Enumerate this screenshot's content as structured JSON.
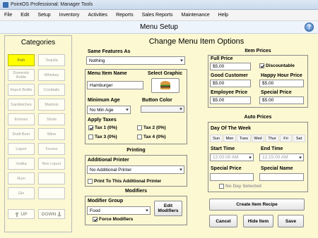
{
  "window": {
    "title": "PointOS Professional: Manager Tools"
  },
  "menu": [
    "File",
    "Edit",
    "Setup",
    "Inventory",
    "Activities",
    "Reports",
    "Sales Reports",
    "Maintenance",
    "Help"
  ],
  "header": {
    "title": "Menu Setup",
    "help_icon": "?"
  },
  "categories": {
    "title": "Categories",
    "items": [
      "Fish",
      "Tequila",
      "Domestic Bottle",
      "Whiskey",
      "Import Bottle",
      "Cocktails",
      "Sandwiches",
      "Martinis",
      "Entrees",
      "Shots",
      "Draft Beer",
      "Wine",
      "Liquor",
      "Frozen",
      "Vodka",
      "Non Liquor",
      "Rum",
      "",
      "Gin",
      ""
    ],
    "selected": "Fish",
    "up_label": "UP",
    "down_label": "DOWN"
  },
  "main_title": "Change Menu Item Options",
  "features": {
    "label": "Same Features As",
    "value": "Nothing"
  },
  "item": {
    "name_label": "Menu Item Name",
    "name_value": "Hamburger",
    "graphic_label": "Select Graphic",
    "min_age_label": "Minimum Age",
    "min_age_value": "No Min Age",
    "button_color_label": "Button Color",
    "taxes_label": "Apply Taxes",
    "taxes": [
      {
        "label": "Tax 1 (0%)",
        "checked": true
      },
      {
        "label": "Tax 2 (0%)",
        "checked": false
      },
      {
        "label": "Tax 3 (0%)",
        "checked": false
      },
      {
        "label": "Tax 4 (0%)",
        "checked": false
      }
    ]
  },
  "printing": {
    "title": "Printing",
    "printer_label": "Additional Printer",
    "printer_value": "No Additional Printer",
    "print_to_label": "Print To This Additional Printer"
  },
  "modifiers": {
    "title": "Modifiers",
    "group_label": "Modifier Group",
    "group_value": "Food",
    "edit_label": "Edit Modifiers",
    "force_label": "Force Modifiers"
  },
  "prices": {
    "title": "Item Prices",
    "full_label": "Full Price",
    "full_value": "$5.00",
    "discountable_label": "Discountable",
    "good_label": "Good Customer",
    "good_value": "$5.00",
    "happy_label": "Happy Hour Price",
    "happy_value": "$5.00",
    "employee_label": "Employee Price",
    "employee_value": "$5.00",
    "special_label": "Special Price",
    "special_value": "$5.00"
  },
  "auto_prices": {
    "title": "Auto Prices",
    "dow_label": "Day Of The Week",
    "days": [
      "Sun",
      "Mon",
      "Tues",
      "Wed",
      "Thur",
      "Fri",
      "Sat"
    ],
    "start_label": "Start Time",
    "start_value": "12:00:00 AM",
    "end_label": "End Time",
    "end_value": "12:15:00 AM",
    "special_price_label": "Special Price",
    "special_name_label": "Special Name",
    "no_day_label": "No Day Selected"
  },
  "actions": {
    "recipe": "Create Item Recipe",
    "cancel": "Cancel",
    "hide": "Hide Item",
    "save": "Save"
  },
  "colors": {
    "background": "#fbf8d2",
    "selected_category": "#ffff00",
    "header": "#eef4fb"
  }
}
